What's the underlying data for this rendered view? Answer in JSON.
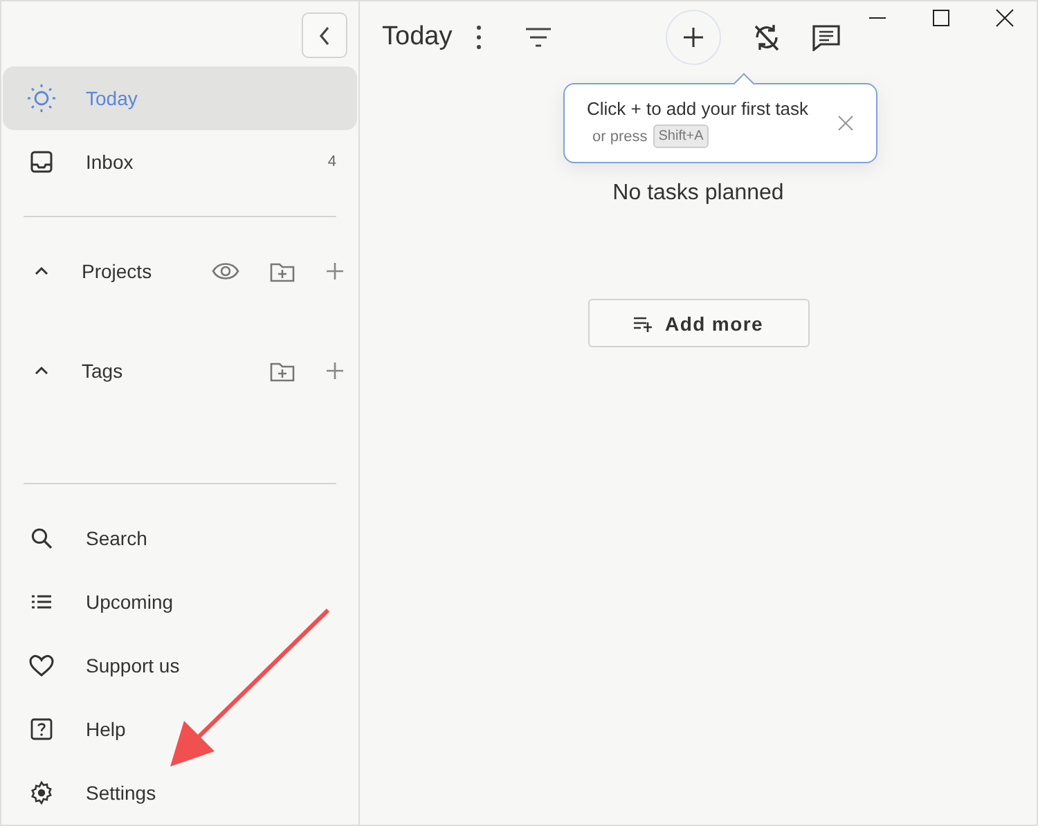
{
  "sidebar": {
    "nav": [
      {
        "label": "Today",
        "selected": true
      },
      {
        "label": "Inbox",
        "selected": false,
        "count": "4"
      }
    ],
    "sections": [
      {
        "label": "Projects",
        "expanded": true,
        "actions": [
          {
            "kind": "visibility"
          },
          {
            "kind": "folder"
          },
          {
            "kind": "add"
          }
        ]
      },
      {
        "label": "Tags",
        "expanded": true,
        "actions": [
          {
            "kind": "folder"
          },
          {
            "kind": "add"
          }
        ]
      }
    ],
    "bottom": [
      {
        "label": "Search"
      },
      {
        "label": "Upcoming"
      },
      {
        "label": "Support us"
      },
      {
        "label": "Help"
      },
      {
        "label": "Settings"
      }
    ]
  },
  "header": {
    "title": "Today"
  },
  "tooltip": {
    "text": "Click + to add your first task",
    "hint": "or press",
    "key": "Shift+A"
  },
  "empty_message": "No tasks planned",
  "add_button": "Add more"
}
